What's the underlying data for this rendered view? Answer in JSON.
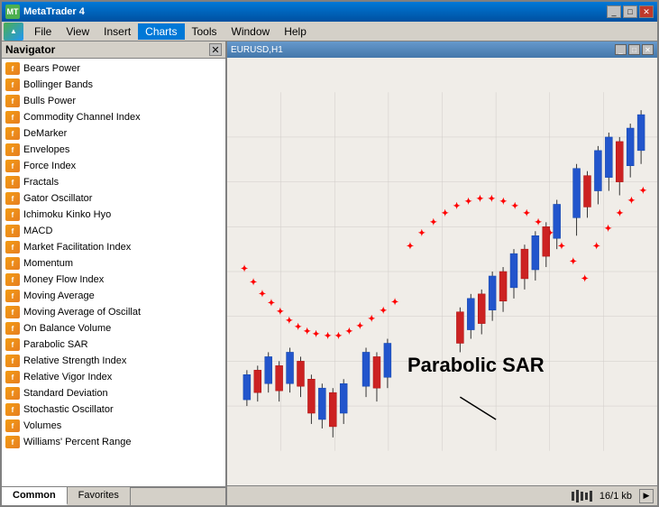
{
  "window": {
    "title": "MetaTrader 4",
    "titlebar_controls": [
      "_",
      "□",
      "✕"
    ]
  },
  "menubar": {
    "items": [
      "File",
      "View",
      "Insert",
      "Charts",
      "Tools",
      "Window",
      "Help"
    ]
  },
  "navigator": {
    "title": "Navigator",
    "items": [
      "Bears Power",
      "Bollinger Bands",
      "Bulls Power",
      "Commodity Channel Index",
      "DeMarker",
      "Envelopes",
      "Force Index",
      "Fractals",
      "Gator Oscillator",
      "Ichimoku Kinko Hyo",
      "MACD",
      "Market Facilitation Index",
      "Momentum",
      "Money Flow Index",
      "Moving Average",
      "Moving Average of Oscillat",
      "On Balance Volume",
      "Parabolic SAR",
      "Relative Strength Index",
      "Relative Vigor Index",
      "Standard Deviation",
      "Stochastic Oscillator",
      "Volumes",
      "Williams' Percent Range"
    ],
    "tabs": [
      "Common",
      "Favorites"
    ]
  },
  "chart": {
    "inner_title": "EURUSD,H1",
    "sar_label": "Parabolic SAR"
  },
  "statusbar": {
    "info": "16/1 kb",
    "segments": [
      "",
      "",
      "",
      "",
      "16/1 kb",
      ""
    ]
  }
}
